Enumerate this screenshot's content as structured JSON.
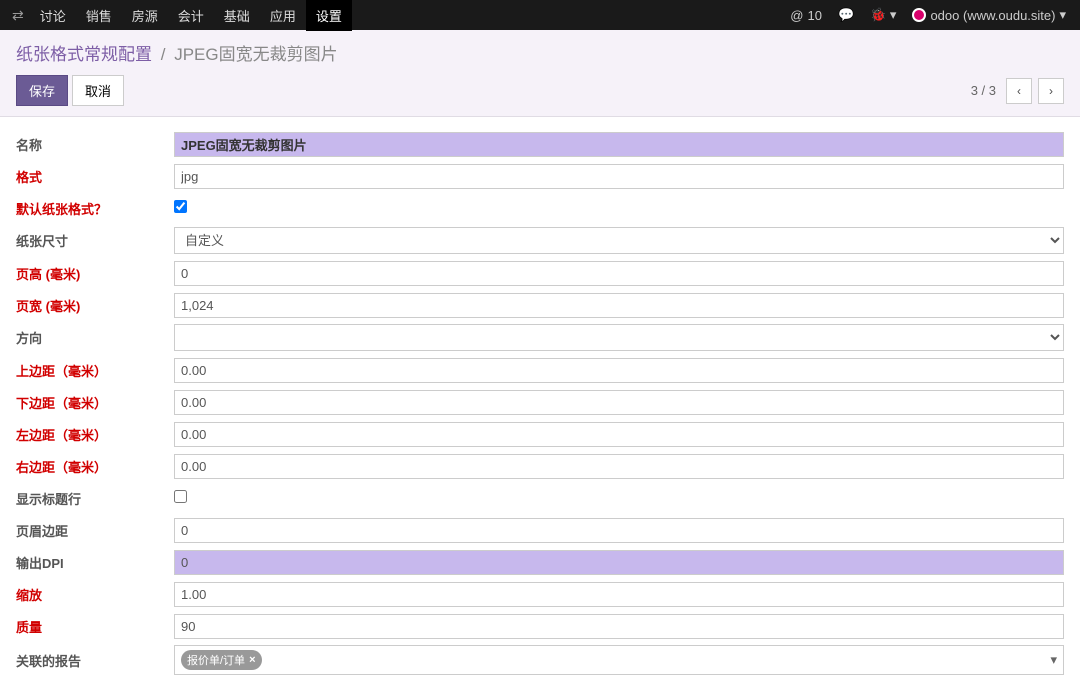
{
  "topbar": {
    "menu": [
      "讨论",
      "销售",
      "房源",
      "会计",
      "基础",
      "应用",
      "设置"
    ],
    "active_index": 6,
    "msg_count": "10",
    "user_label": "odoo (www.oudu.site)"
  },
  "breadcrumb": {
    "parent": "纸张格式常规配置",
    "current": "JPEG固宽无裁剪图片"
  },
  "buttons": {
    "save": "保存",
    "discard": "取消"
  },
  "pager": {
    "text": "3 / 3"
  },
  "labels": {
    "name": "名称",
    "format": "格式",
    "default": "默认纸张格式？",
    "paper_size": "纸张尺寸",
    "page_height": "页高 (毫米)",
    "page_width": "页宽 (毫米)",
    "orientation": "方向",
    "margin_top": "上边距（毫米）",
    "margin_bottom": "下边距（毫米）",
    "margin_left": "左边距（毫米）",
    "margin_right": "右边距（毫米）",
    "header_line": "显示标题行",
    "header_spacing": "页眉边距",
    "dpi": "输出DPI",
    "zoom": "缩放",
    "quality": "质量",
    "reports": "关联的报告"
  },
  "values": {
    "name": "JPEG固宽无裁剪图片",
    "format": "jpg",
    "default": true,
    "paper_size": "自定义",
    "page_height": "0",
    "page_width": "1,024",
    "orientation": "",
    "margin_top": "0.00",
    "margin_bottom": "0.00",
    "margin_left": "0.00",
    "margin_right": "0.00",
    "header_line": false,
    "header_spacing": "0",
    "dpi": "0",
    "zoom": "1.00",
    "quality": "90",
    "report_tag": "报价单/订单"
  }
}
